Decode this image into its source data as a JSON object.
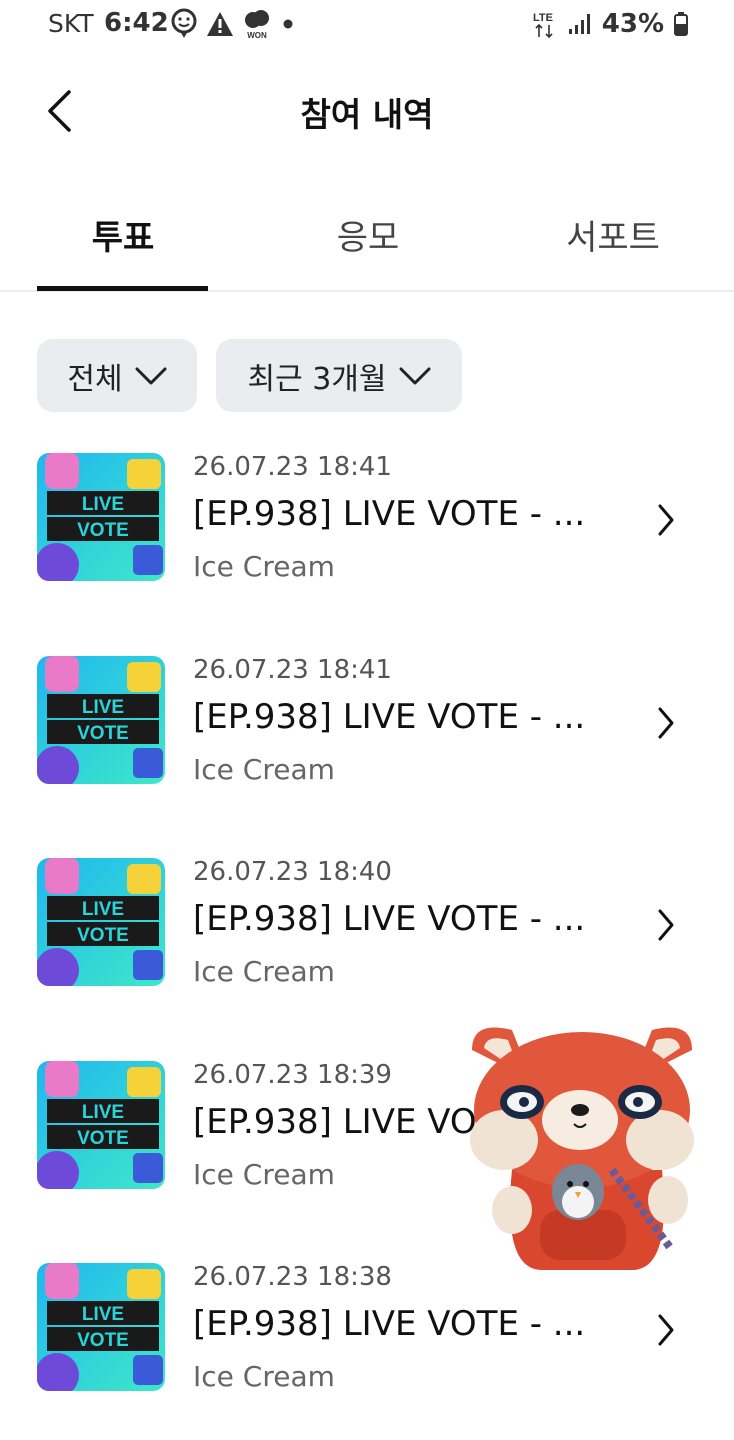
{
  "status_bar": {
    "carrier": "SKT",
    "time": "6:42",
    "network": "LTE",
    "battery": "43%",
    "icons": [
      "face-icon",
      "warning-icon",
      "won-icon",
      "dot-icon",
      "signal-icon",
      "battery-icon"
    ]
  },
  "header": {
    "title": "참여 내역"
  },
  "tabs": [
    {
      "label": "투표",
      "active": true
    },
    {
      "label": "응모",
      "active": false
    },
    {
      "label": "서포트",
      "active": false
    }
  ],
  "filters": {
    "category": "전체",
    "period": "최근 3개월"
  },
  "items": [
    {
      "date": "26.07.23 18:41",
      "title": "[EP.938] LIVE VOTE - ...",
      "subtitle": "Ice Cream",
      "thumb_line1": "LIVE",
      "thumb_line2": "VOTE"
    },
    {
      "date": "26.07.23 18:41",
      "title": "[EP.938] LIVE VOTE - ...",
      "subtitle": "Ice Cream",
      "thumb_line1": "LIVE",
      "thumb_line2": "VOTE"
    },
    {
      "date": "26.07.23 18:40",
      "title": "[EP.938] LIVE VOTE - ...",
      "subtitle": "Ice Cream",
      "thumb_line1": "LIVE",
      "thumb_line2": "VOTE"
    },
    {
      "date": "26.07.23 18:39",
      "title": "[EP.938] LIVE VOTE - ...",
      "subtitle": "Ice Cream",
      "thumb_line1": "LIVE",
      "thumb_line2": "VOTE"
    },
    {
      "date": "26.07.23 18:38",
      "title": "[EP.938] LIVE VOTE - ...",
      "subtitle": "Ice Cream",
      "thumb_line1": "LIVE",
      "thumb_line2": "VOTE"
    }
  ],
  "colors": {
    "text_primary": "#111111",
    "text_secondary": "#666666",
    "chip_bg": "#ebecef",
    "thumb_cyan": "#2ad4d9",
    "thumb_pink": "#e87ac8",
    "thumb_yellow": "#f5d23a",
    "sticker_red": "#e0573b"
  }
}
